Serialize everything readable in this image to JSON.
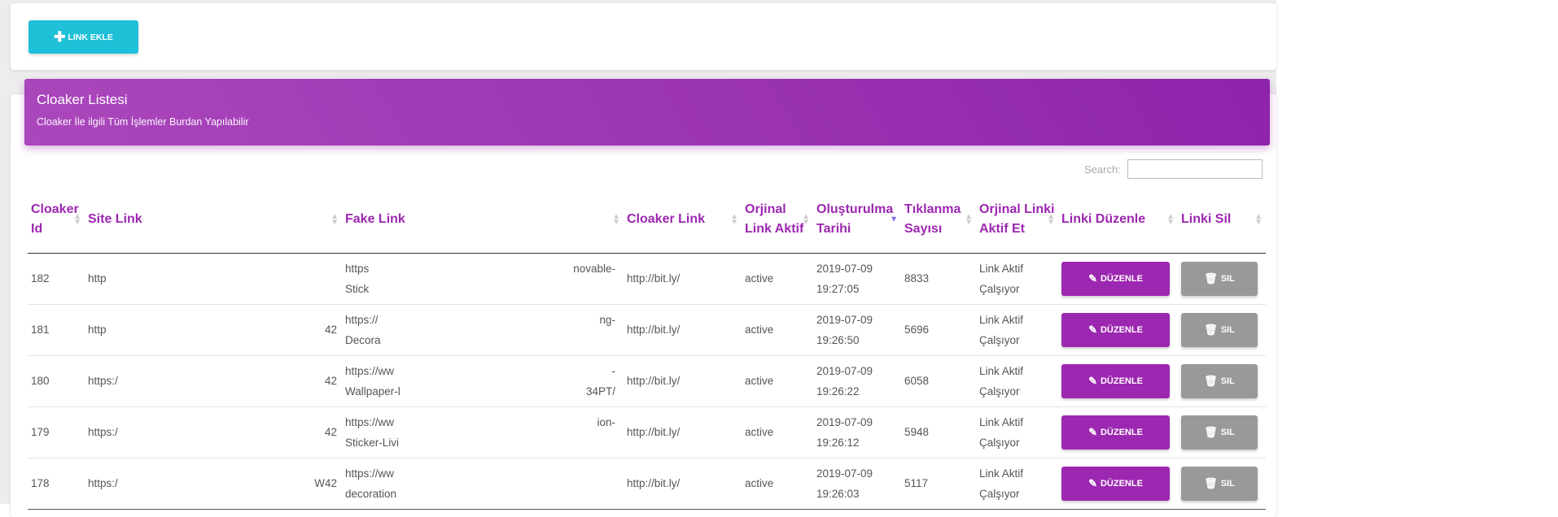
{
  "toolbar": {
    "add_link_label": "LINK EKLE",
    "add_icon": "plus-icon"
  },
  "card": {
    "title": "Cloaker Listesi",
    "subtitle": "Cloaker İle ilgili Tüm İşlemler Burdan Yapılabilir",
    "header_color": "#9c27b0"
  },
  "search": {
    "label": "Search:",
    "value": ""
  },
  "table": {
    "headers": {
      "id": "Cloaker Id",
      "site": "Site Link",
      "fake": "Fake Link",
      "cloaker": "Cloaker Link",
      "orjinal": "Orjinal Link Aktif",
      "created": "Oluşturulma Tarihi",
      "clicks": "Tıklanma Sayısı",
      "active": "Orjinal Linki Aktif Et",
      "edit": "Linki Düzenle",
      "delete": "Linki Sil"
    },
    "rows": [
      {
        "id": "182",
        "site": "http",
        "site_end": "",
        "fake1": "https",
        "fake1_end": "novable-",
        "fake2": "Stick",
        "fake2_end": "",
        "cloaker": "http://bit.ly/",
        "orjinal": "active",
        "date": "2019-07-09",
        "time": "19:27:05",
        "clicks": "8833",
        "status1": "Link Aktif",
        "status2": "Çalşıyor"
      },
      {
        "id": "181",
        "site": "http",
        "site_end": "42",
        "fake1": "https://",
        "fake1_end": "ng-",
        "fake2": "Decora",
        "fake2_end": "",
        "cloaker": "http://bit.ly/",
        "orjinal": "active",
        "date": "2019-07-09",
        "time": "19:26:50",
        "clicks": "5696",
        "status1": "Link Aktif",
        "status2": "Çalşıyor"
      },
      {
        "id": "180",
        "site": "https:/",
        "site_end": "42",
        "fake1": "https://ww",
        "fake1_end": "-",
        "fake2": "Wallpaper-l",
        "fake2_end": "34PT/",
        "cloaker": "http://bit.ly/",
        "orjinal": "active",
        "date": "2019-07-09",
        "time": "19:26:22",
        "clicks": "6058",
        "status1": "Link Aktif",
        "status2": "Çalşıyor"
      },
      {
        "id": "179",
        "site": "https:/",
        "site_end": "42",
        "fake1": "https://ww",
        "fake1_end": "ion-",
        "fake2": "Sticker-Livi",
        "fake2_end": "",
        "cloaker": "http://bit.ly/",
        "orjinal": "active",
        "date": "2019-07-09",
        "time": "19:26:12",
        "clicks": "5948",
        "status1": "Link Aktif",
        "status2": "Çalşıyor"
      },
      {
        "id": "178",
        "site": "https:/",
        "site_end": "W42",
        "fake1": "https://ww",
        "fake1_end": "",
        "fake2": "decoration",
        "fake2_end": "",
        "cloaker": "http://bit.ly/",
        "orjinal": "active",
        "date": "2019-07-09",
        "time": "19:26:03",
        "clicks": "5117",
        "status1": "Link Aktif",
        "status2": "Çalşıyor"
      }
    ],
    "edit_label": "DÜZENLE",
    "delete_label": "SIL"
  }
}
